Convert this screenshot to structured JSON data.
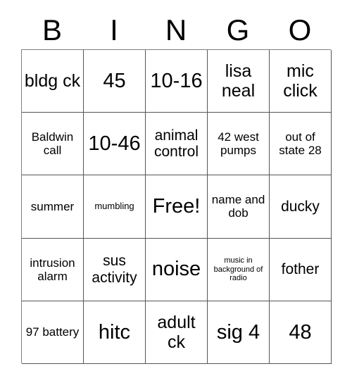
{
  "card": {
    "type": "bingo-card",
    "columns": 5,
    "rows": 5,
    "border_color": "#555555",
    "background_color": "#ffffff",
    "text_color": "#000000"
  },
  "header": {
    "letters": [
      {
        "label": "B"
      },
      {
        "label": "I"
      },
      {
        "label": "N"
      },
      {
        "label": "G"
      },
      {
        "label": "O"
      }
    ]
  },
  "grid": {
    "cells": [
      {
        "text": "bldg ck",
        "size": "fs-lg",
        "free": false
      },
      {
        "text": "45",
        "size": "fs-xl",
        "free": false
      },
      {
        "text": "10-16",
        "size": "fs-xl",
        "free": false
      },
      {
        "text": "lisa neal",
        "size": "fs-lg",
        "free": false
      },
      {
        "text": "mic click",
        "size": "fs-lg",
        "free": false
      },
      {
        "text": "Baldwin call",
        "size": "fs-sm",
        "free": false
      },
      {
        "text": "10-46",
        "size": "fs-xl",
        "free": false
      },
      {
        "text": "animal control",
        "size": "fs-md",
        "free": false
      },
      {
        "text": "42 west pumps",
        "size": "fs-sm",
        "free": false
      },
      {
        "text": "out of state 28",
        "size": "fs-sm",
        "free": false
      },
      {
        "text": "summer",
        "size": "fs-sm",
        "free": false
      },
      {
        "text": "mumbling",
        "size": "fs-xs",
        "free": false
      },
      {
        "text": "Free!",
        "size": "fs-xl",
        "free": true
      },
      {
        "text": "name and dob",
        "size": "fs-sm",
        "free": false
      },
      {
        "text": "ducky",
        "size": "fs-md",
        "free": false
      },
      {
        "text": "intrusion alarm",
        "size": "fs-sm",
        "free": false
      },
      {
        "text": "sus activity",
        "size": "fs-md",
        "free": false
      },
      {
        "text": "noise",
        "size": "fs-xl",
        "free": false
      },
      {
        "text": "music in background of radio",
        "size": "fs-xxs",
        "free": false
      },
      {
        "text": "fother",
        "size": "fs-md",
        "free": false
      },
      {
        "text": "97 battery",
        "size": "fs-sm",
        "free": false
      },
      {
        "text": "hitc",
        "size": "fs-xl",
        "free": false
      },
      {
        "text": "adult ck",
        "size": "fs-lg",
        "free": false
      },
      {
        "text": "sig 4",
        "size": "fs-xl",
        "free": false
      },
      {
        "text": "48",
        "size": "fs-xl",
        "free": false
      }
    ]
  }
}
